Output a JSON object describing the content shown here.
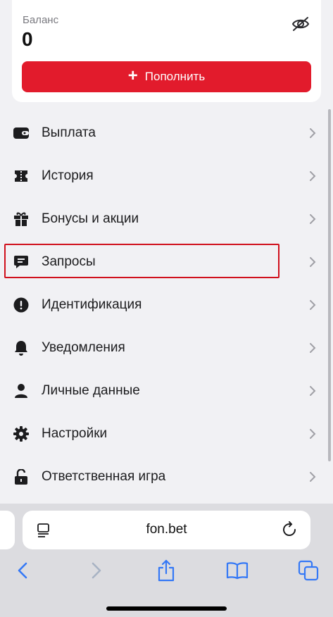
{
  "balance": {
    "label": "Баланс",
    "value": "0",
    "topup_label": "Пополнить"
  },
  "menu": {
    "items": [
      {
        "label": "Выплата",
        "icon": "wallet-icon"
      },
      {
        "label": "История",
        "icon": "ticket-icon"
      },
      {
        "label": "Бонусы и акции",
        "icon": "gift-icon"
      },
      {
        "label": "Запросы",
        "icon": "chat-icon"
      },
      {
        "label": "Идентификация",
        "icon": "exclamation-circle-icon"
      },
      {
        "label": "Уведомления",
        "icon": "bell-icon"
      },
      {
        "label": "Личные данные",
        "icon": "person-icon"
      },
      {
        "label": "Настройки",
        "icon": "gear-icon"
      },
      {
        "label": "Ответственная игра",
        "icon": "unlock-icon"
      }
    ]
  },
  "browser": {
    "url": "fon.bet"
  },
  "colors": {
    "accent": "#e21b2c",
    "highlight_border": "#d0101c",
    "ios_blue": "#3478f6"
  }
}
